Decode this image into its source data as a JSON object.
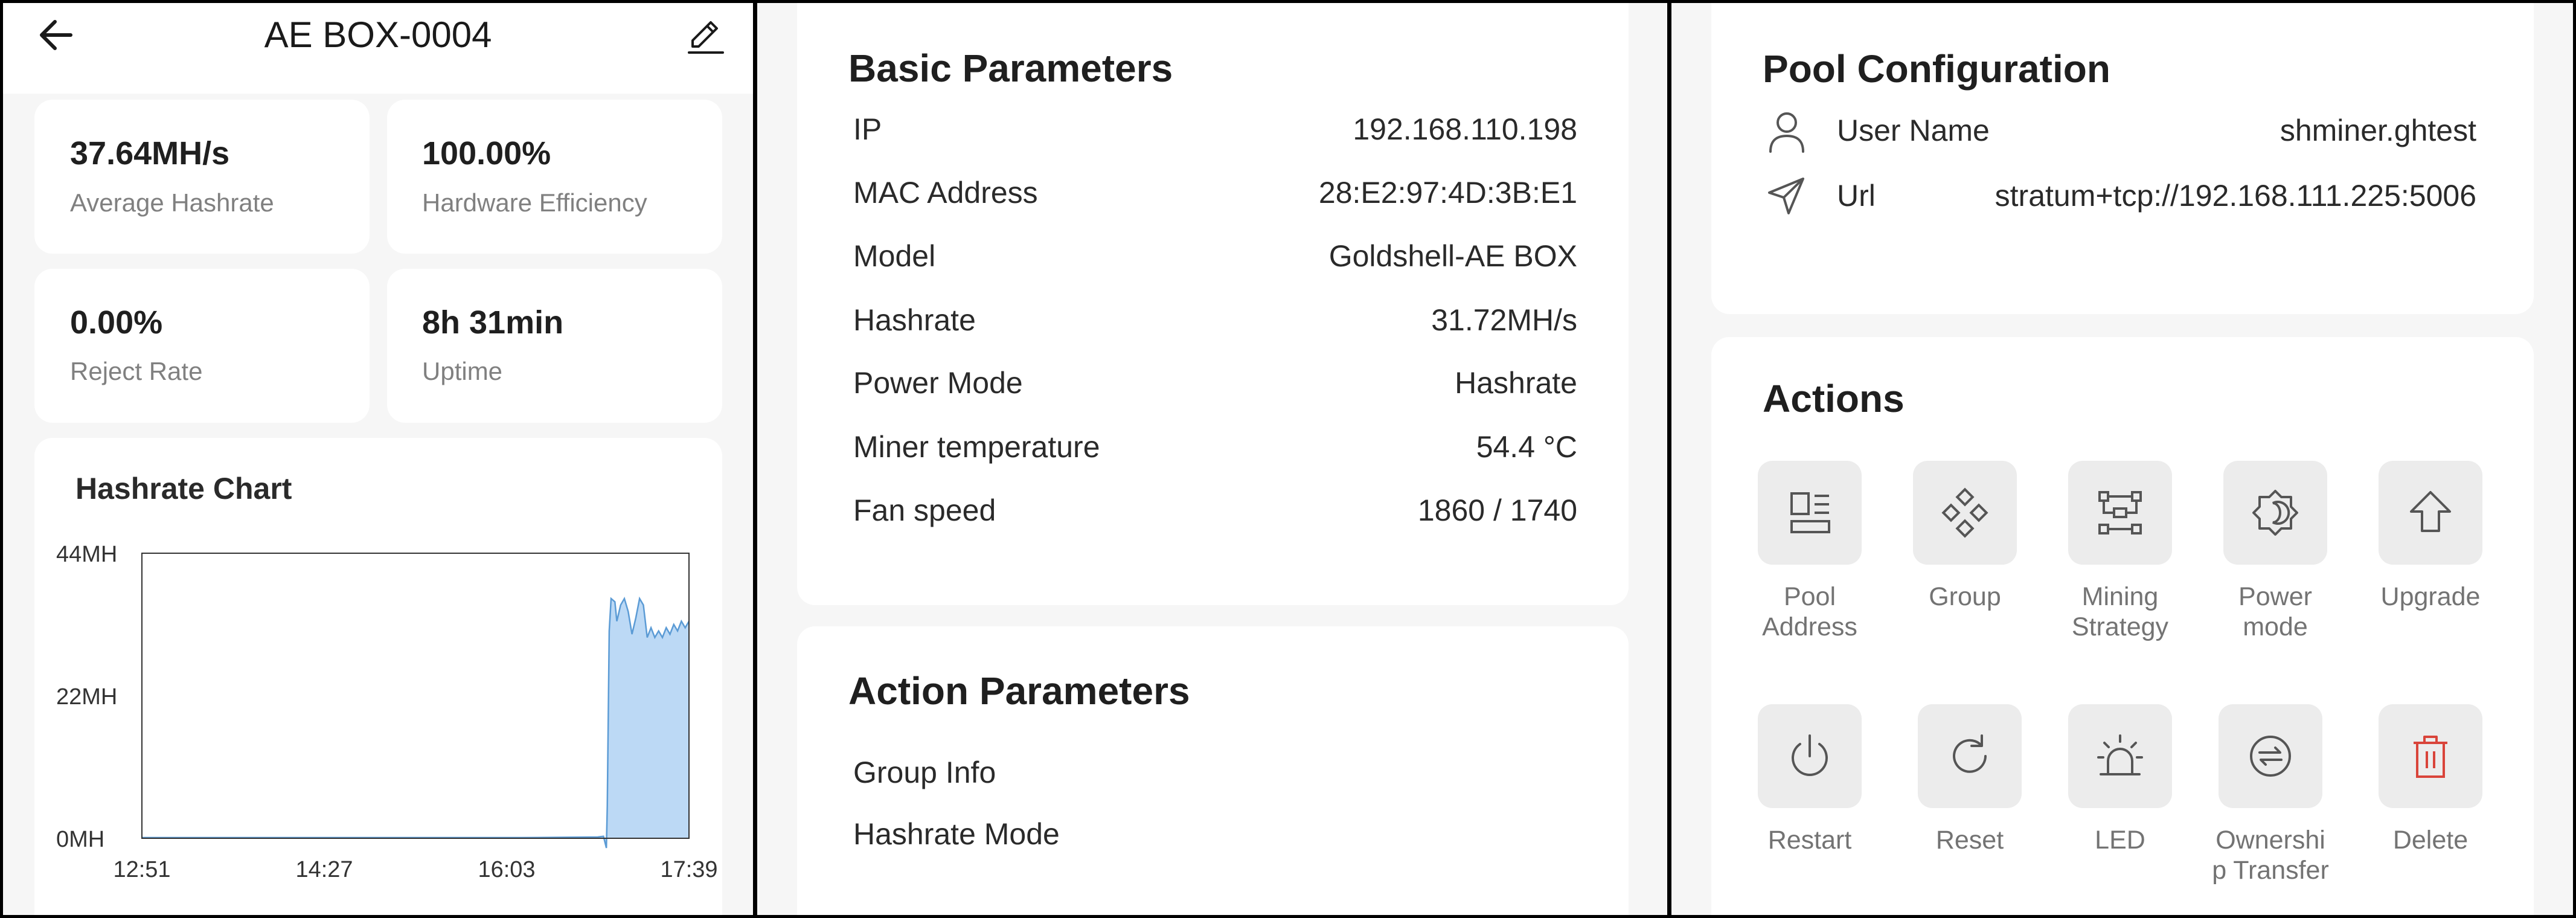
{
  "device": {
    "title": "AE BOX-0004",
    "back_icon": "back-arrow-icon",
    "edit_icon": "pencil-edit-icon"
  },
  "stats": [
    {
      "value": "37.64MH/s",
      "label": "Average Hashrate"
    },
    {
      "value": "100.00%",
      "label": "Hardware Efficiency"
    },
    {
      "value": "0.00%",
      "label": "Reject Rate"
    },
    {
      "value": "8h 31min",
      "label": "Uptime"
    }
  ],
  "hashrate_chart": {
    "title": "Hashrate Chart"
  },
  "chart_data": {
    "type": "area",
    "title": "Hashrate Chart",
    "xlabel": "",
    "ylabel": "",
    "x_tick_labels": [
      "12:51",
      "14:27",
      "16:03",
      "17:39"
    ],
    "y_tick_labels": [
      "44MH",
      "22MH",
      "0MH"
    ],
    "ylim": [
      0,
      44
    ],
    "x_range_minutes": [
      0,
      288
    ],
    "grid": false,
    "series": [
      {
        "color": "#5b9bd5",
        "fill": "#bcd9f5",
        "points": [
          [
            0,
            0.1
          ],
          [
            40,
            0.1
          ],
          [
            80,
            0.1
          ],
          [
            120,
            0.1
          ],
          [
            160,
            0.1
          ],
          [
            200,
            0.1
          ],
          [
            240,
            0.2
          ],
          [
            243,
            0.3
          ],
          [
            244.5,
            -1.5
          ],
          [
            245,
            5
          ],
          [
            246,
            32
          ],
          [
            247,
            37
          ],
          [
            249,
            36.5
          ],
          [
            250,
            33.5
          ],
          [
            252,
            36
          ],
          [
            254,
            37
          ],
          [
            256,
            35
          ],
          [
            258,
            31.5
          ],
          [
            260,
            34
          ],
          [
            262,
            37
          ],
          [
            264,
            36
          ],
          [
            266,
            31
          ],
          [
            268,
            32.5
          ],
          [
            270,
            31
          ],
          [
            272,
            32
          ],
          [
            274,
            31
          ],
          [
            276,
            32.5
          ],
          [
            278,
            31.5
          ],
          [
            280,
            33
          ],
          [
            282,
            32
          ],
          [
            284,
            33.5
          ],
          [
            286,
            32.5
          ],
          [
            288,
            33.5
          ]
        ]
      }
    ]
  },
  "basic_parameters": {
    "title": "Basic Parameters",
    "rows": [
      {
        "label": "IP",
        "value": "192.168.110.198"
      },
      {
        "label": "MAC Address",
        "value": "28:E2:97:4D:3B:E1"
      },
      {
        "label": "Model",
        "value": "Goldshell-AE BOX"
      },
      {
        "label": "Hashrate",
        "value": "31.72MH/s"
      },
      {
        "label": "Power Mode",
        "value": "Hashrate"
      },
      {
        "label": "Miner temperature",
        "value": "54.4 °C"
      },
      {
        "label": "Fan speed",
        "value": "1860 / 1740"
      }
    ]
  },
  "action_parameters": {
    "title": "Action Parameters",
    "items": [
      "Group Info",
      "Hashrate Mode"
    ]
  },
  "pool_configuration": {
    "title": "Pool Configuration",
    "rows": [
      {
        "icon": "user-icon",
        "label": "User Name",
        "value": "shminer.ghtest"
      },
      {
        "icon": "send-icon",
        "label": "Url",
        "value": "stratum+tcp://192.168.111.225:5006"
      }
    ]
  },
  "actions": {
    "title": "Actions",
    "items": [
      {
        "icon": "pool-address-icon",
        "line1": "Pool",
        "line2": "Address"
      },
      {
        "icon": "group-icon",
        "line1": "Group",
        "line2": ""
      },
      {
        "icon": "mining-strategy-icon",
        "line1": "Mining",
        "line2": "Strategy"
      },
      {
        "icon": "power-mode-icon",
        "line1": "Power",
        "line2": "mode"
      },
      {
        "icon": "upgrade-icon",
        "line1": "Upgrade",
        "line2": ""
      },
      {
        "icon": "restart-icon",
        "line1": "Restart",
        "line2": ""
      },
      {
        "icon": "reset-icon",
        "line1": "Reset",
        "line2": ""
      },
      {
        "icon": "led-icon",
        "line1": "LED",
        "line2": ""
      },
      {
        "icon": "ownership-transfer-icon",
        "line1": "Ownershi",
        "line2": "p Transfer"
      },
      {
        "icon": "delete-icon",
        "line1": "Delete",
        "line2": ""
      }
    ],
    "delete_color": "#d9443a"
  }
}
